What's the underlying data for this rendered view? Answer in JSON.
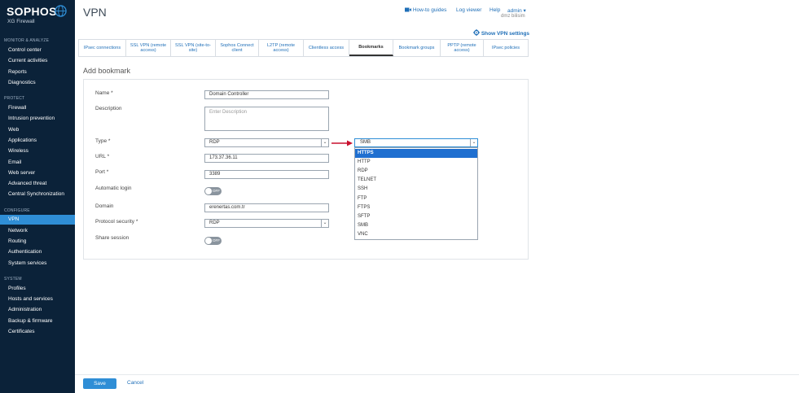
{
  "brand": {
    "name": "SOPHOS",
    "product": "XG Firewall",
    "accent": "#2f8ed6",
    "sidebar_bg": "#0b2239"
  },
  "sidebar": {
    "sections": [
      {
        "heading": "MONITOR & ANALYZE",
        "items": [
          "Control center",
          "Current activities",
          "Reports",
          "Diagnostics"
        ]
      },
      {
        "heading": "PROTECT",
        "items": [
          "Firewall",
          "Intrusion prevention",
          "Web",
          "Applications",
          "Wireless",
          "Email",
          "Web server",
          "Advanced threat",
          "Central Synchronization"
        ]
      },
      {
        "heading": "CONFIGURE",
        "items": [
          "VPN",
          "Network",
          "Routing",
          "Authentication",
          "System services"
        ]
      },
      {
        "heading": "SYSTEM",
        "items": [
          "Profiles",
          "Hosts and services",
          "Administration",
          "Backup & firmware",
          "Certificates"
        ]
      }
    ],
    "active_item": "VPN"
  },
  "header": {
    "title": "VPN",
    "how_to": "How-to guides",
    "log_viewer": "Log viewer",
    "help": "Help",
    "user": "admin ▾",
    "sub_user": "dmz bilisim",
    "show_settings": "Show VPN settings"
  },
  "tabs": [
    {
      "label": "IPsec connections"
    },
    {
      "label": "SSL VPN (remote access)"
    },
    {
      "label": "SSL VPN (site-to-site)"
    },
    {
      "label": "Sophos Connect client"
    },
    {
      "label": "L2TP (remote access)"
    },
    {
      "label": "Clientless access"
    },
    {
      "label": "Bookmarks",
      "active": true
    },
    {
      "label": "Bookmark groups"
    },
    {
      "label": "PPTP (remote access)"
    },
    {
      "label": "IPsec policies"
    }
  ],
  "form": {
    "section_title": "Add bookmark",
    "name_label": "Name *",
    "name_value": "Domain Controller",
    "description_label": "Description",
    "description_placeholder": "Enter Description",
    "type_label": "Type *",
    "type_value": "RDP",
    "url_label": "URL *",
    "url_value": "173.37.36.11",
    "port_label": "Port *",
    "port_value": "3389",
    "autologin_label": "Automatic login",
    "autologin_state": "OFF",
    "domain_label": "Domain",
    "domain_value": "erenertas.com.tr",
    "protocol_security_label": "Protocol security *",
    "protocol_security_value": "RDP",
    "share_session_label": "Share session",
    "share_session_state": "OFF"
  },
  "dropdown": {
    "selected_value": "SMB",
    "options": [
      "HTTPS",
      "HTTP",
      "RDP",
      "TELNET",
      "SSH",
      "FTP",
      "FTPS",
      "SFTP",
      "SMB",
      "VNC"
    ],
    "highlighted": "HTTPS"
  },
  "footer": {
    "save": "Save",
    "cancel": "Cancel"
  }
}
